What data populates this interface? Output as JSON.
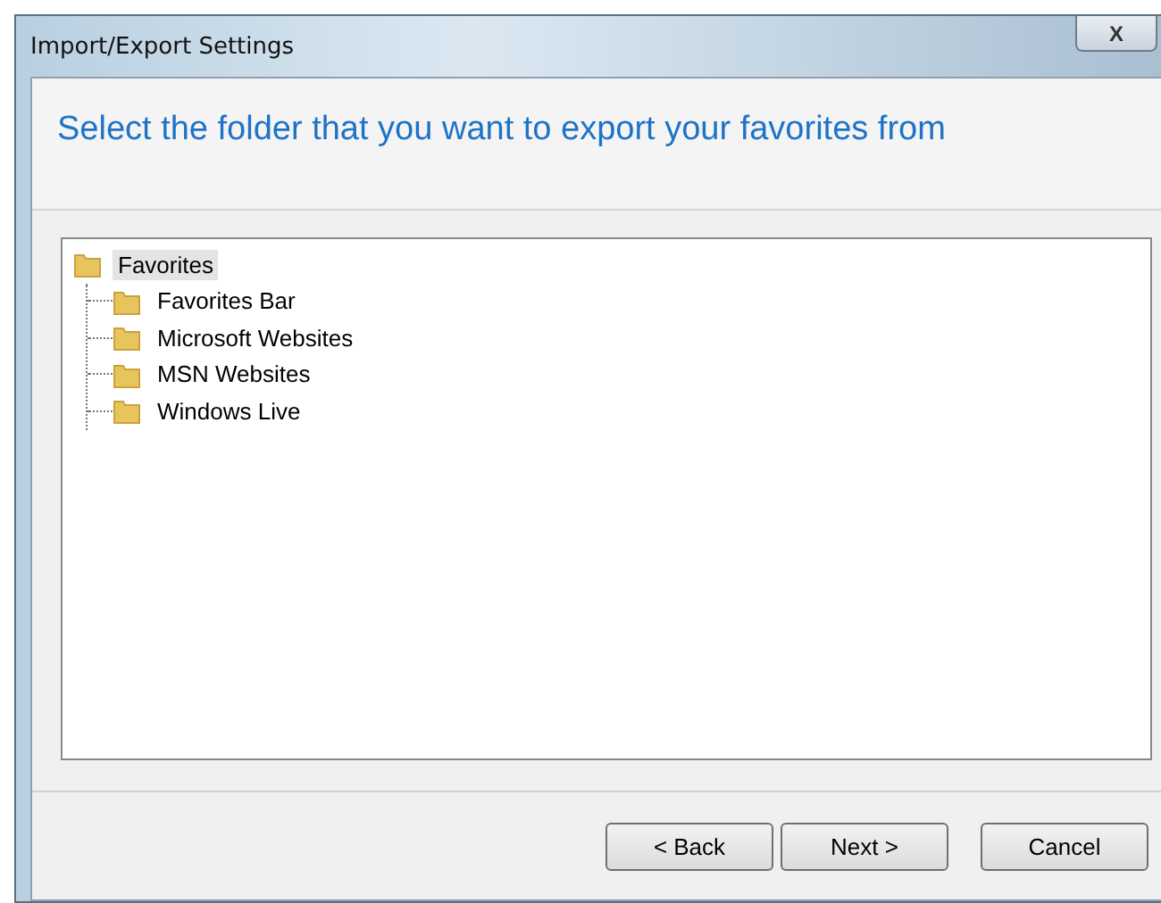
{
  "window": {
    "title": "Import/Export Settings",
    "close": "X"
  },
  "heading": "Select the folder that you want to export your favorites from",
  "tree": [
    {
      "label": "Favorites",
      "selected": true,
      "children": [
        {
          "label": "Favorites Bar",
          "selected": false
        },
        {
          "label": "Microsoft Websites",
          "selected": false
        },
        {
          "label": "MSN Websites",
          "selected": false
        },
        {
          "label": "Windows Live",
          "selected": false
        }
      ]
    }
  ],
  "buttons": [
    "< Back",
    "Next >",
    "Cancel"
  ]
}
